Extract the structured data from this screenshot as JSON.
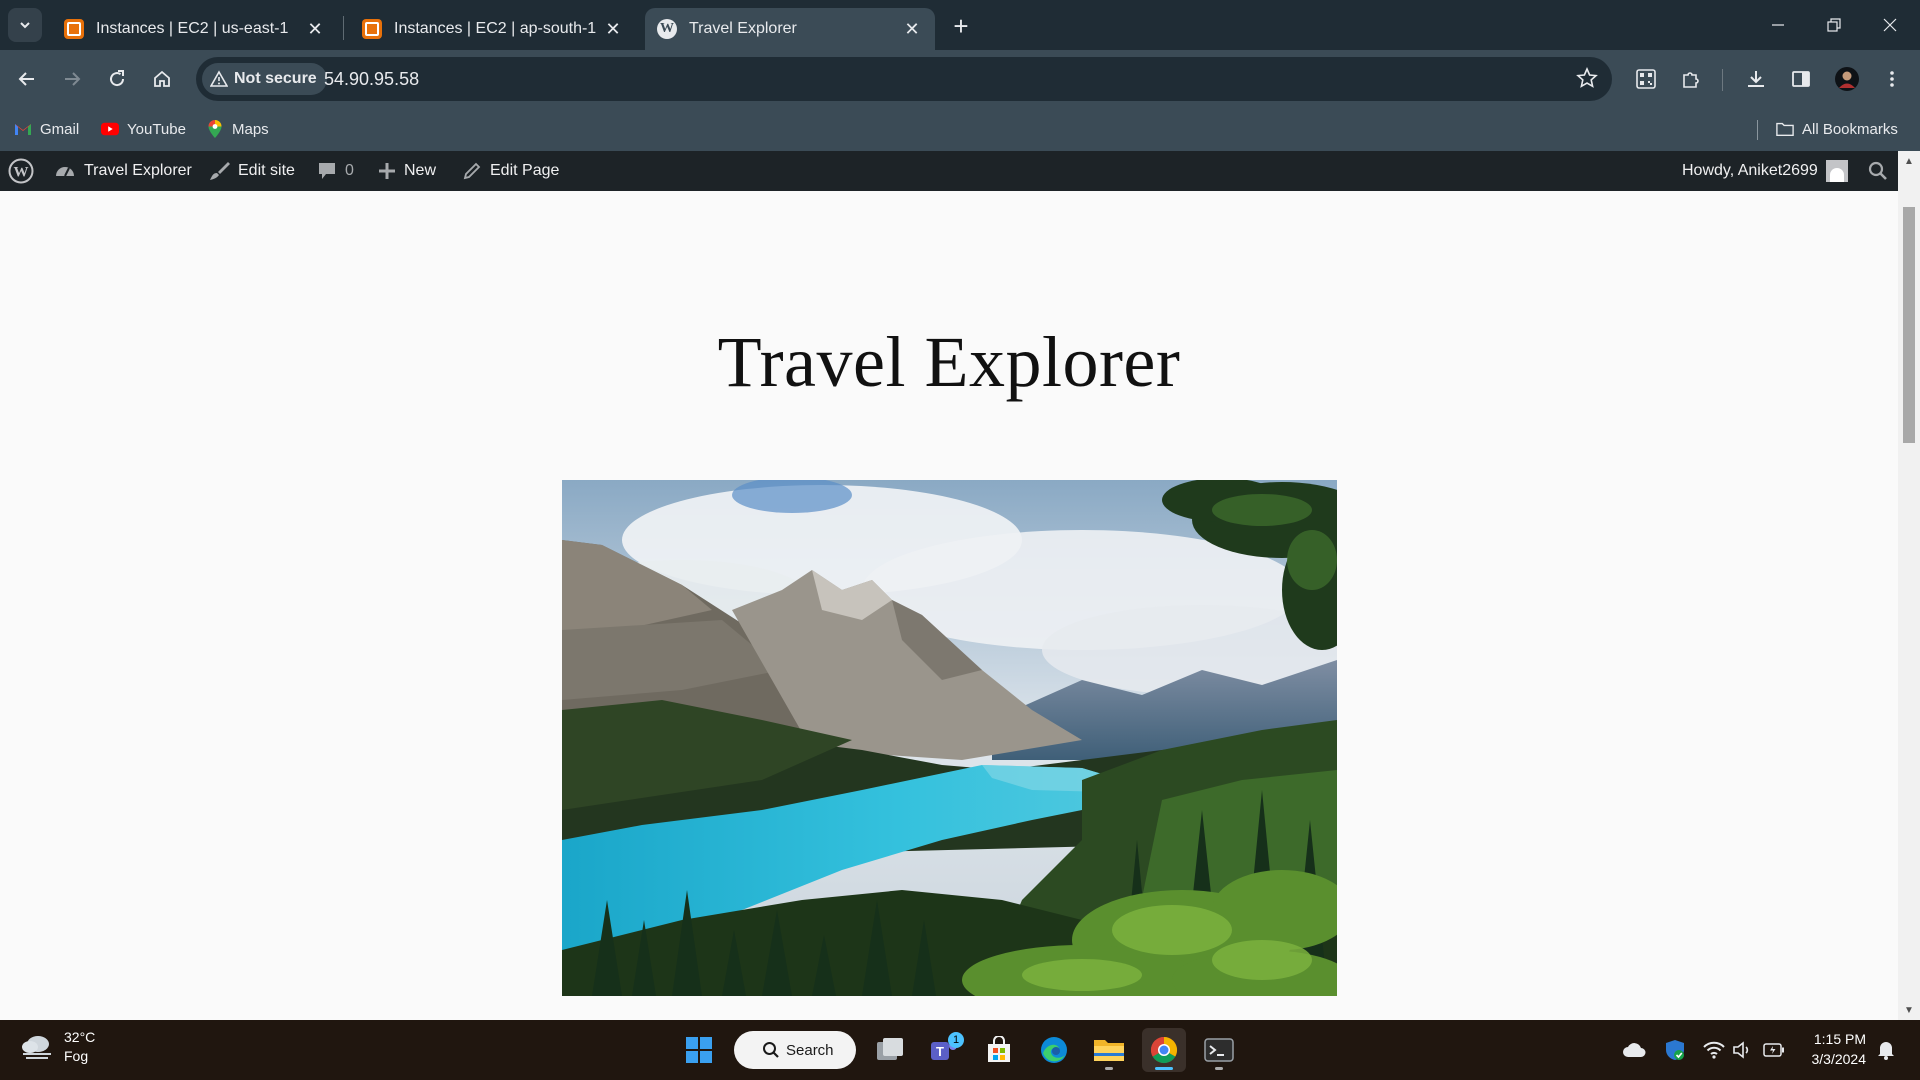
{
  "browser": {
    "tabs": [
      {
        "title": "Instances | EC2 | us-east-1",
        "favicon": "aws-ec2-icon"
      },
      {
        "title": "Instances | EC2 | ap-south-1",
        "favicon": "aws-ec2-icon"
      },
      {
        "title": "Travel Explorer",
        "favicon": "wordpress-icon",
        "active": true
      }
    ],
    "security_label": "Not secure",
    "url": "54.90.95.58",
    "bookmarks": [
      {
        "label": "Gmail",
        "icon": "gmail-icon"
      },
      {
        "label": "YouTube",
        "icon": "youtube-icon"
      },
      {
        "label": "Maps",
        "icon": "maps-icon"
      }
    ],
    "all_bookmarks_label": "All Bookmarks",
    "colors": {
      "frame": "#1f2c35",
      "toolbar": "#3b4b56"
    }
  },
  "wp_admin_bar": {
    "site_name": "Travel Explorer",
    "edit_site": "Edit site",
    "comments_count": "0",
    "new_label": "New",
    "edit_page": "Edit Page",
    "greeting": "Howdy, Aniket2699"
  },
  "page": {
    "site_title": "Travel Explorer",
    "hero_image": "mountain-lake-landscape"
  },
  "taskbar": {
    "weather_temp": "32°C",
    "weather_desc": "Fog",
    "search_label": "Search",
    "teams_badge": "1",
    "time": "1:15 PM",
    "date": "3/3/2024"
  }
}
